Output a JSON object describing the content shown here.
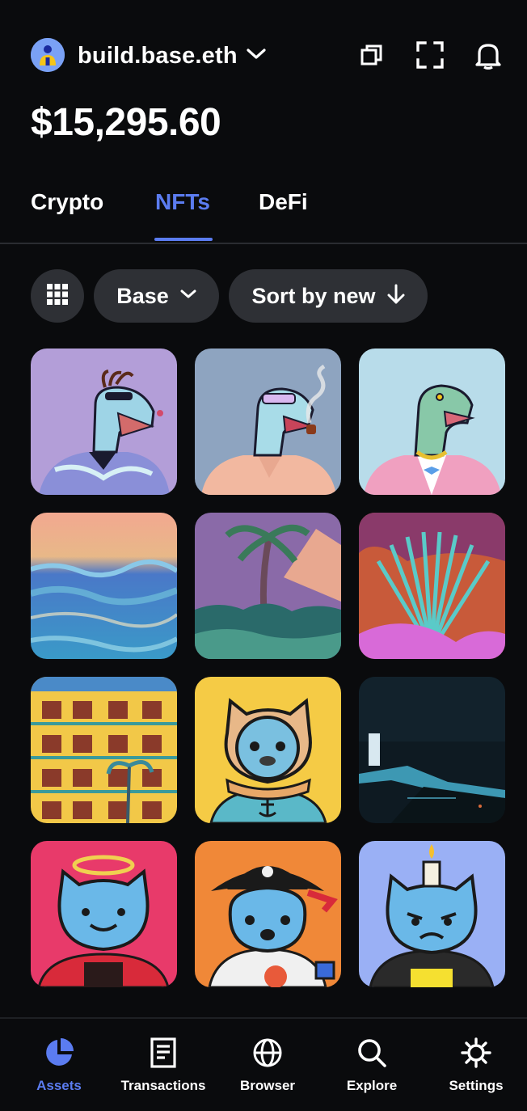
{
  "header": {
    "account_name": "build.base.eth",
    "balance": "$15,295.60",
    "icons": [
      "copy-icon",
      "scan-icon",
      "bell-icon"
    ]
  },
  "tabs": [
    {
      "label": "Crypto",
      "active": false
    },
    {
      "label": "NFTs",
      "active": true
    },
    {
      "label": "DeFi",
      "active": false
    }
  ],
  "filters": {
    "grid_icon": "grid-icon",
    "network": "Base",
    "sort": "Sort by new"
  },
  "nfts": [
    {
      "subject": "dino-purple-shirt"
    },
    {
      "subject": "dino-smoking-pipe"
    },
    {
      "subject": "dino-pink-suit"
    },
    {
      "subject": "ocean-waves"
    },
    {
      "subject": "palm-tree-mountains"
    },
    {
      "subject": "tropical-leaves"
    },
    {
      "subject": "hotel-building"
    },
    {
      "subject": "cat-diver-helmet"
    },
    {
      "subject": "dark-coast-night"
    },
    {
      "subject": "cat-halo-hoodie"
    },
    {
      "subject": "cat-pirate-astronaut"
    },
    {
      "subject": "cat-candle-hoodie"
    }
  ],
  "bottom_nav": [
    {
      "label": "Assets",
      "icon": "pie-chart-icon",
      "active": true
    },
    {
      "label": "Transactions",
      "icon": "document-icon",
      "active": false
    },
    {
      "label": "Browser",
      "icon": "globe-icon",
      "active": false
    },
    {
      "label": "Explore",
      "icon": "search-icon",
      "active": false
    },
    {
      "label": "Settings",
      "icon": "gear-icon",
      "active": false
    }
  ],
  "colors": {
    "background": "#0a0b0d",
    "accent": "#5b7cf0",
    "pill": "#2e3035"
  }
}
